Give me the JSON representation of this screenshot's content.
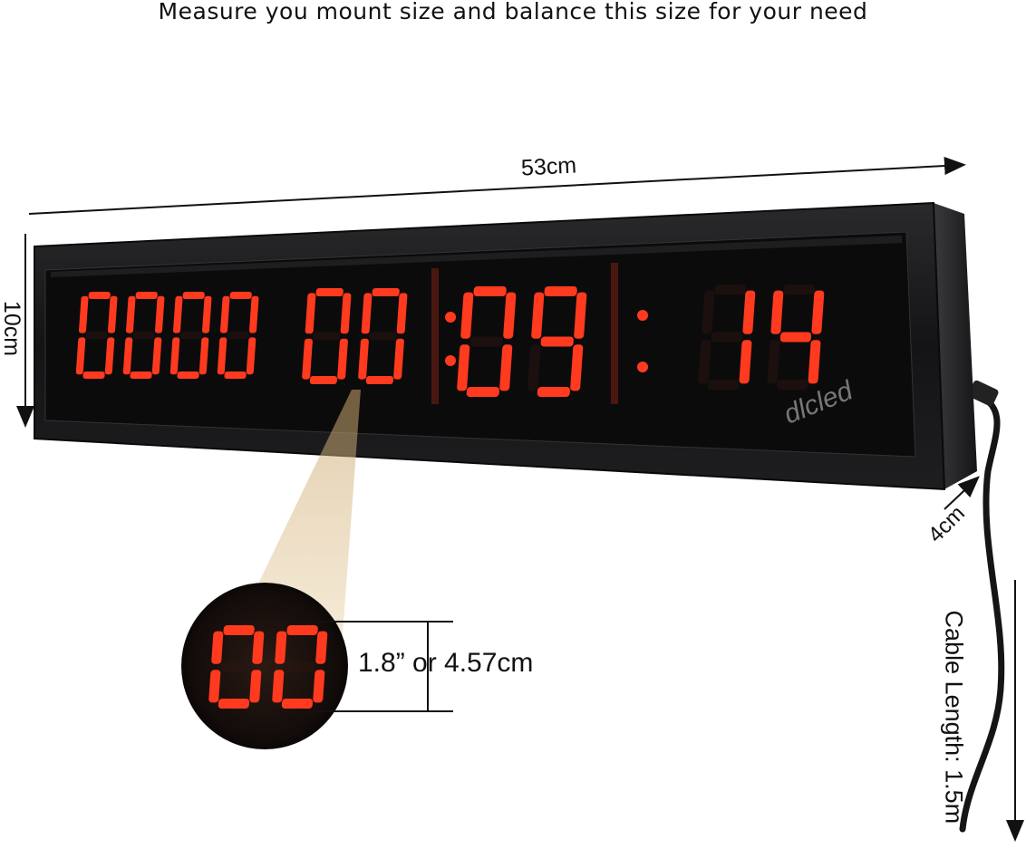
{
  "headline": "Measure you mount size and balance this size for your need",
  "dimensions": {
    "width": "53cm",
    "height": "10cm",
    "depth": "4cm",
    "cable": "Cable Length: 1.5m",
    "digit_height": "1.8” or 4.57cm"
  },
  "display": {
    "groups": [
      "0000",
      "00",
      "09",
      "14"
    ],
    "zoom_digits": "00",
    "brand_watermark": "dlcled",
    "led_color": "#ff3a1e"
  }
}
